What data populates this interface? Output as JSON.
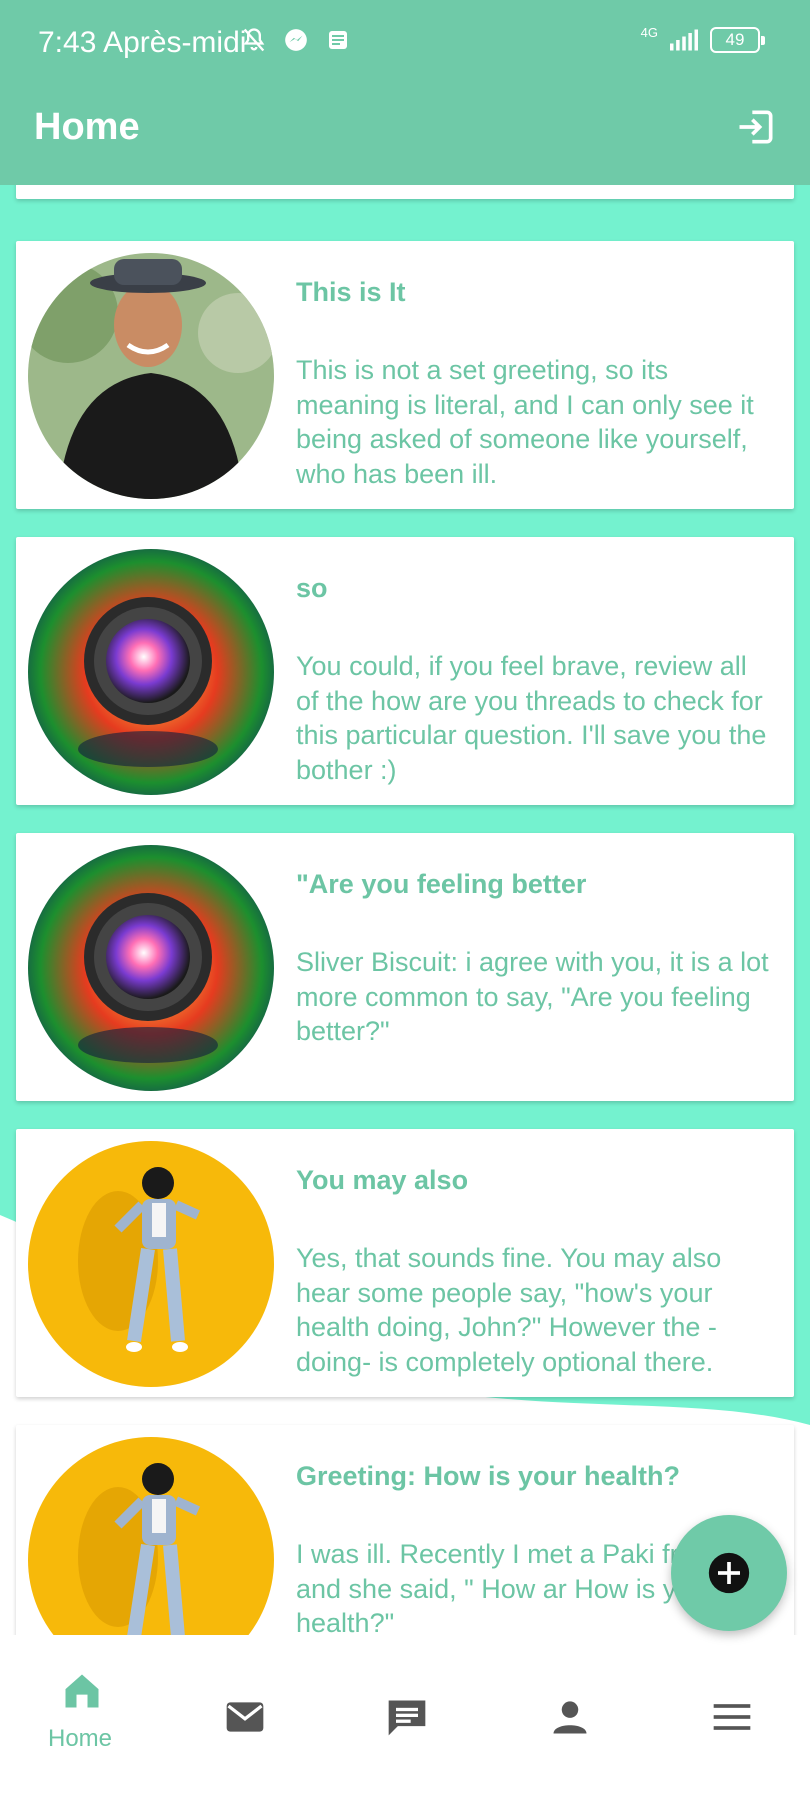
{
  "status_bar": {
    "time": "7:43 Après-midi",
    "network": "4G",
    "battery": "49",
    "icons": [
      "mute-icon",
      "messenger-icon",
      "notes-icon",
      "signal-icon",
      "battery-icon"
    ]
  },
  "app_bar": {
    "title": "Home",
    "action_icon": "logout-icon"
  },
  "posts": [
    {
      "avatar": "man-with-hat-photo",
      "title": "This is It",
      "body": "This is not a set greeting, so its meaning is literal, and I can only see it being asked of someone like yourself, who has been ill."
    },
    {
      "avatar": "camera-lens-photo",
      "title": "so",
      "body": "You could, if you feel brave, review all of the how are you threads to check for this particular question. I'll save you the bother :)"
    },
    {
      "avatar": "camera-lens-photo",
      "title": "\"Are you feeling better",
      "body": "Sliver Biscuit: i agree with you, it is a lot more common to say, \"Are you feeling better?\""
    },
    {
      "avatar": "dancing-woman-photo",
      "title": "You may also",
      "body": "Yes, that sounds fine. You may also hear some people say, \"how's your health doing, John?\" However the -doing- is completely optional there."
    },
    {
      "avatar": "dancing-woman-photo",
      "title": "Greeting: How is your health?",
      "body": "I was ill. Recently I met a Paki friend, and she said, \" How ar How is your health?\""
    }
  ],
  "fab": {
    "icon": "add-icon"
  },
  "bottom_nav": [
    {
      "icon": "home-icon",
      "label": "Home",
      "active": true
    },
    {
      "icon": "mail-icon",
      "label": "",
      "active": false
    },
    {
      "icon": "chat-icon",
      "label": "",
      "active": false
    },
    {
      "icon": "person-icon",
      "label": "",
      "active": false
    },
    {
      "icon": "menu-icon",
      "label": "",
      "active": false
    }
  ],
  "colors": {
    "primary": "#6fcaa8",
    "background": "#74f2cf",
    "text_accent": "#6cc5a4",
    "nav_inactive": "#555555"
  }
}
